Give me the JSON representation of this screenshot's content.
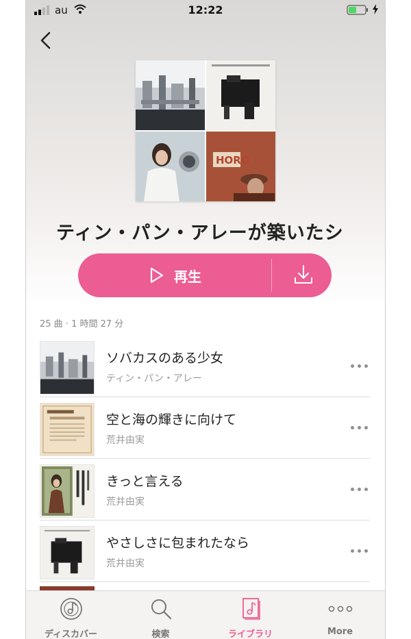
{
  "status_bar": {
    "carrier": "au",
    "time": "12:22",
    "battery_color": "#4cd964"
  },
  "header": {
    "back_icon": "chevron-left-icon"
  },
  "playlist": {
    "title": "ティン・パン・アレーが築いたシ",
    "play_label": "再生",
    "download_icon": "download-icon",
    "summary": "25 曲 · 1 時間 27 分",
    "accent_color": "#ec5d93"
  },
  "tracks": [
    {
      "title": "ソバカスのある少女",
      "artist": "ティン・パン・アレー"
    },
    {
      "title": "空と海の輝きに向けて",
      "artist": "荒井由実"
    },
    {
      "title": "きっと言える",
      "artist": "荒井由実"
    },
    {
      "title": "やさしさに包まれたなら",
      "artist": "荒井由実"
    }
  ],
  "tab_bar": {
    "tabs": [
      {
        "label": "ディスカバー",
        "icon": "discover-disc-icon",
        "active": false
      },
      {
        "label": "検索",
        "icon": "search-icon",
        "active": false
      },
      {
        "label": "ライブラリ",
        "icon": "library-music-note-icon",
        "active": true
      },
      {
        "label": "More",
        "icon": "more-dots-icon",
        "active": false
      }
    ]
  }
}
